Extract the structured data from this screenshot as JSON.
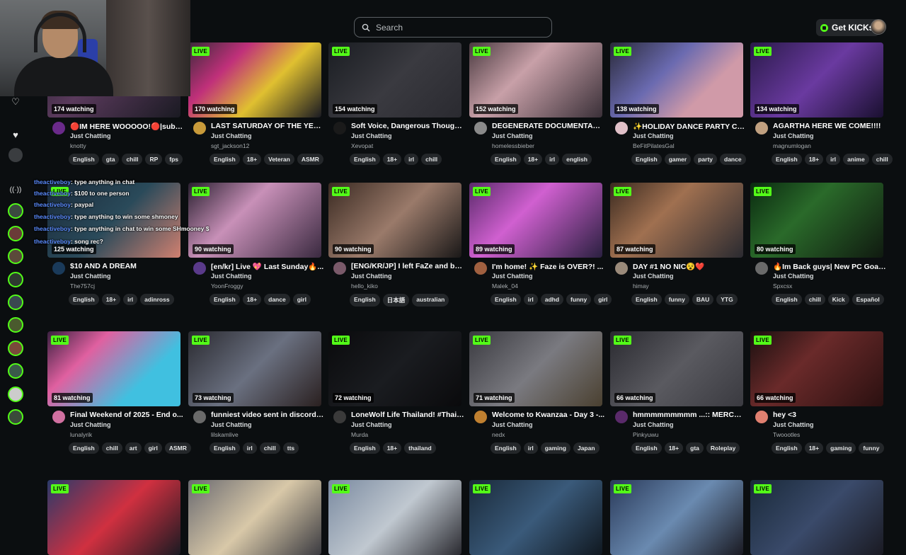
{
  "search": {
    "placeholder": "Search"
  },
  "header": {
    "get_kicks_label": "Get KICKs"
  },
  "colors": {
    "accent": "#53fc18",
    "background": "#0b0e10",
    "tag_bg": "#24272a"
  },
  "sidebar": {
    "icons": [
      "heart-outline-icon",
      "heart-icon",
      "avatar-icon",
      "broadcast-icon"
    ]
  },
  "chat_overlay": [
    {
      "user": "theactiveboy",
      "message": ": type anything in chat"
    },
    {
      "user": "theactiveboy",
      "message": ": $100 to one person"
    },
    {
      "user": "theactiveboy",
      "message": ": paypal"
    },
    {
      "user": "theactiveboy",
      "message": ": type anything to win some shmoney"
    },
    {
      "user": "theactiveboy",
      "message": ": type anything in chat to win some SHmooney $"
    },
    {
      "user": "theactiveboy",
      "message": ": song rec?"
    }
  ],
  "streams": [
    {
      "live": "LIVE",
      "watching": "174 watching",
      "title": "🔴IM HERE WOOOOO!🔴|sub ...",
      "category": "Just Chatting",
      "user": "knotty",
      "tags": [
        "English",
        "gta",
        "chill",
        "RP",
        "fps"
      ]
    },
    {
      "live": "LIVE",
      "watching": "170 watching",
      "title": "LAST SATURDAY OF THE YEA...",
      "category": "Just Chatting",
      "user": "sgt_jackson12",
      "tags": [
        "English",
        "18+",
        "Veteran",
        "ASMR"
      ]
    },
    {
      "live": "LIVE",
      "watching": "154 watching",
      "title": "Soft Voice, Dangerous Thoughts",
      "category": "Just Chatting",
      "user": "Xevopat",
      "tags": [
        "English",
        "18+",
        "irl",
        "chill"
      ]
    },
    {
      "live": "LIVE",
      "watching": "152 watching",
      "title": "DEGENERATE DOCUMENTARI...",
      "category": "Just Chatting",
      "user": "homelessbieber",
      "tags": [
        "English",
        "18+",
        "irl",
        "english"
      ]
    },
    {
      "live": "LIVE",
      "watching": "138 watching",
      "title": "✨HOLIDAY DANCE PARTY CO...",
      "category": "Just Chatting",
      "user": "BeFitPilatesGal",
      "tags": [
        "English",
        "gamer",
        "party",
        "dance"
      ]
    },
    {
      "live": "LIVE",
      "watching": "134 watching",
      "title": "AGARTHA HERE WE COME!!!!",
      "category": "Just Chatting",
      "user": "magnumlogan",
      "tags": [
        "English",
        "18+",
        "irl",
        "anime",
        "chill"
      ]
    },
    {
      "live": "LIVE",
      "watching": "125 watching",
      "title": "$10 AND A DREAM",
      "category": "Just Chatting",
      "user": "The757cj",
      "tags": [
        "English",
        "18+",
        "irl",
        "adinross"
      ]
    },
    {
      "live": "LIVE",
      "watching": "90 watching",
      "title": "[en/kr] Live 💖 Last Sunday🔥...",
      "category": "Just Chatting",
      "user": "YoonFroggy",
      "tags": [
        "English",
        "18+",
        "dance",
        "girl"
      ]
    },
    {
      "live": "LIVE",
      "watching": "90 watching",
      "title": "[ENG/KR/JP] I left FaZe and be...",
      "category": "Just Chatting",
      "user": "hello_kiko",
      "tags": [
        "English",
        "日本語",
        "australian"
      ]
    },
    {
      "live": "LIVE",
      "watching": "89 watching",
      "title": "I'm home! ✨ Faze is OVER?! ...",
      "category": "Just Chatting",
      "user": "Malek_04",
      "tags": [
        "English",
        "irl",
        "adhd",
        "funny",
        "girl"
      ]
    },
    {
      "live": "LIVE",
      "watching": "87 watching",
      "title": "DAY #1 NO NIC😵❤️",
      "category": "Just Chatting",
      "user": "himay",
      "tags": [
        "English",
        "funny",
        "BAU",
        "YTG"
      ]
    },
    {
      "live": "LIVE",
      "watching": "80 watching",
      "title": "🔥Im Back guys| New PC Goal...",
      "category": "Just Chatting",
      "user": "Spxcsx",
      "tags": [
        "English",
        "chill",
        "Kick",
        "Español"
      ]
    },
    {
      "live": "LIVE",
      "watching": "81 watching",
      "title": "Final Weekend of 2025 - End o...",
      "category": "Just Chatting",
      "user": "lunalyrik",
      "tags": [
        "English",
        "chill",
        "art",
        "girl",
        "ASMR"
      ]
    },
    {
      "live": "LIVE",
      "watching": "73 watching",
      "title": "funniest video sent in discord ...",
      "category": "Just Chatting",
      "user": "lilskamlive",
      "tags": [
        "English",
        "irl",
        "chill",
        "tts"
      ]
    },
    {
      "live": "LIVE",
      "watching": "72 watching",
      "title": "LoneWolf Life Thailand! #Thail...",
      "category": "Just Chatting",
      "user": "Murda",
      "tags": [
        "English",
        "18+",
        "thailand"
      ]
    },
    {
      "live": "LIVE",
      "watching": "71 watching",
      "title": "Welcome to Kwanzaa - Day 3 -...",
      "category": "Just Chatting",
      "user": "nedx",
      "tags": [
        "English",
        "irl",
        "gaming",
        "Japan"
      ]
    },
    {
      "live": "LIVE",
      "watching": "66 watching",
      "title": "hmmmmmmmmm ...:: MERCY ...",
      "category": "Just Chatting",
      "user": "Pinkyuwu",
      "tags": [
        "English",
        "18+",
        "gta",
        "Roleplay"
      ]
    },
    {
      "live": "LIVE",
      "watching": "66 watching",
      "title": "hey <3",
      "category": "Just Chatting",
      "user": "Twoootles",
      "tags": [
        "English",
        "18+",
        "gaming",
        "funny"
      ]
    },
    {
      "live": "LIVE"
    },
    {
      "live": "LIVE"
    },
    {
      "live": "LIVE"
    },
    {
      "live": "LIVE"
    },
    {
      "live": "LIVE"
    },
    {
      "live": "LIVE"
    }
  ]
}
